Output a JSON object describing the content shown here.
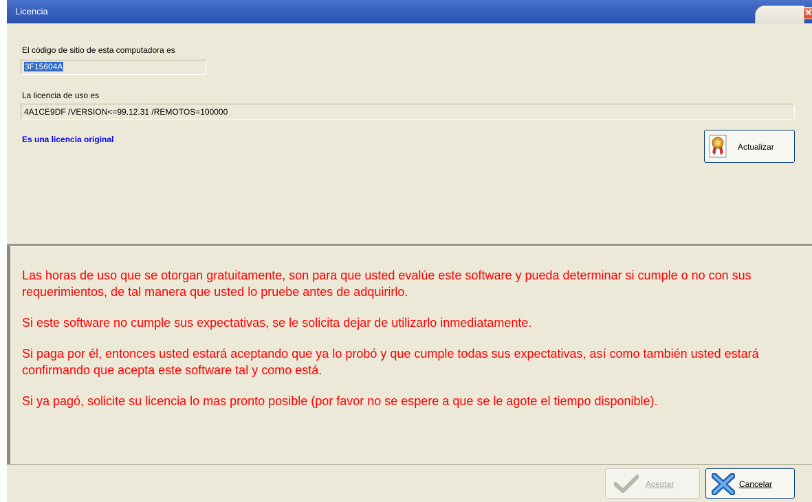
{
  "window": {
    "title": "Licencia",
    "close_glyph": "✕"
  },
  "site_code": {
    "label": "El código de sitio de esta computadora es",
    "value": "3F15604A"
  },
  "license": {
    "label": "La licencia de uso es",
    "value": "4A1CE9DF /VERSION<=99.12.31 /REMOTOS=100000",
    "status": "Es una licencia original",
    "status_color": "#0000ff"
  },
  "buttons": {
    "update_label": "Actualizar",
    "update_icon": "award-ribbon-icon",
    "accept_label": "Aceptar",
    "accept_icon": "checkmark-icon",
    "accept_enabled": false,
    "cancel_label": "Cancelar",
    "cancel_icon": "x-cancel-icon"
  },
  "notice": {
    "color": "#ff0000",
    "paragraphs": [
      "Las horas de uso que se otorgan gratuitamente, son para que usted evalúe este software y pueda determinar si cumple o no con sus requerimientos, de tal manera que usted lo pruebe antes de adquirirlo.",
      "Si este software no cumple sus expectativas, se le solicita dejar de utilizarlo inmediatamente.",
      "Si paga por él, entonces usted estará aceptando que ya lo probó y que cumple todas sus expectativas, así como también usted estará confirmando que acepta este software tal y como está.",
      "Si ya pagó, solicite su licencia lo mas pronto posible (por favor no se espere a que se le agote el tiempo disponible)."
    ]
  }
}
